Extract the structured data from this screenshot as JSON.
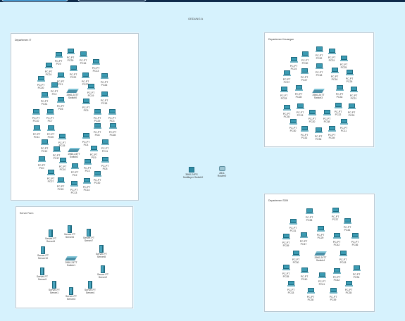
{
  "canvas_title": "GEDUNG A",
  "core": [
    {
      "model": "3560-24PS",
      "name": "Multilayer Switch0",
      "kind": "msw"
    },
    {
      "model": "2811",
      "name": "Router0",
      "kind": "rtr"
    }
  ],
  "areas": [
    {
      "label": "Departemen IT",
      "devices": [
        [
          "PC-PT",
          "PC30"
        ],
        [
          "PC-PT",
          "PC9"
        ],
        [
          "PC-PT",
          "PC16"
        ],
        [
          "PC-PT",
          "PC13"
        ],
        [
          "PC-PT",
          "PC24"
        ],
        [
          "PC-PT",
          "PC22"
        ],
        [
          "PC-PT",
          "PC1"
        ],
        [
          "PC-PT",
          "PC27"
        ],
        [
          "PC-PT",
          "PC26"
        ],
        [
          "PC-PT",
          "PC20"
        ],
        [
          "PC-PT",
          "PC2"
        ],
        [
          "PC-PT",
          "PC19"
        ],
        [
          "2960-24TT",
          "Switch0"
        ],
        [
          "PC-PT",
          "PC31"
        ],
        [
          "PC-PT",
          "PC18"
        ],
        [
          "PC-PT",
          "PC6"
        ],
        [
          "PC-PT",
          "PC5"
        ],
        [
          "PC-PT",
          "PC10"
        ],
        [
          "PC-PT",
          "PC7"
        ],
        [
          "PC-PT",
          "PC29"
        ],
        [
          "PC-PT",
          "PC3"
        ],
        [
          "PC-PT",
          "PC11"
        ],
        [
          "PC-PT",
          "PC20"
        ],
        [
          "PC-PT",
          "PC8"
        ],
        [
          "PC-PT",
          "PC28"
        ],
        [
          "PC-PT",
          "PC15"
        ],
        [
          "PC-PT",
          "PC4"
        ],
        [
          "PC-PT",
          "PC12"
        ],
        [
          "PC-PT",
          "PC11"
        ],
        [
          "2960-24TT",
          "Switch2"
        ],
        [
          "PC-PT",
          "PC17"
        ],
        [
          "PC-PT",
          "PC9"
        ],
        [
          "PC-PT",
          "PC0"
        ],
        [
          "PC-PT",
          "PC10"
        ],
        [
          "PC-PT",
          "PC3"
        ],
        [
          "PC-PT",
          "PC8"
        ],
        [
          "PC-PT",
          "PC2"
        ],
        [
          "PC-PT",
          "PC27"
        ],
        [
          "PC-PT",
          "PC30"
        ],
        [
          "PC-PT",
          "PC15"
        ],
        [
          "PC-PT",
          "PC14"
        ],
        [
          "PC-PT",
          "PC13"
        ]
      ]
    },
    {
      "label": "Departemen Keuangan",
      "devices": [
        [
          "PC-PT",
          "PC32"
        ],
        [
          "PC-PT",
          "PC31"
        ],
        [
          "PC-PT",
          "PC30"
        ],
        [
          "PC-PT",
          "PC25"
        ],
        [
          "PC-PT",
          "PC24"
        ],
        [
          "PC-PT",
          "PC18"
        ],
        [
          "PC-PT",
          "PC27"
        ],
        [
          "PC-PT",
          "PC16"
        ],
        [
          "PC-PT",
          "PC26"
        ],
        [
          "PC-PT",
          "PC37"
        ],
        [
          "2960-24TT",
          "Switch3"
        ],
        [
          "PC-PT",
          "PC28"
        ],
        [
          "PC-PT",
          "PC33"
        ],
        [
          "PC-PT",
          "PC34"
        ],
        [
          "PC-PT",
          "PC21"
        ],
        [
          "PC-PT",
          "PC13"
        ],
        [
          "PC-PT",
          "PC35"
        ],
        [
          "PC-PT",
          "PC22"
        ],
        [
          "PC-PT",
          "PC20"
        ],
        [
          "PC-PT",
          "PC20"
        ],
        [
          "PC-PT",
          "PC38"
        ],
        [
          "PC-PT",
          "PC30"
        ],
        [
          "PC-PT",
          "PC11"
        ],
        [
          "PC-PT",
          "PC32"
        ],
        [
          "PC-PT",
          "PC36"
        ],
        [
          "PC-PT",
          "PC39"
        ]
      ]
    },
    {
      "label": "Server Farm",
      "devices": [
        [
          "Server-PT",
          "Server5"
        ],
        [
          "Server-PT",
          "Server6"
        ],
        [
          "Server-PT",
          "Server7"
        ],
        [
          "Server-PT",
          "Server10"
        ],
        [
          "2960-24TT",
          "Switch1"
        ],
        [
          "Server-PT",
          "Server8"
        ],
        [
          "Server-PT",
          "Server9"
        ],
        [
          "Server-PT",
          "Server2"
        ],
        [
          "Server-PT",
          "Server1"
        ],
        [
          "Server-PT",
          "Server4"
        ],
        [
          "Server-PT",
          "Server3"
        ]
      ]
    },
    {
      "label": "Departemen SDM",
      "devices": [
        [
          "PC-PT",
          "PC38"
        ],
        [
          "PC-PT",
          "PC37"
        ],
        [
          "PC-PT",
          "PC31"
        ],
        [
          "PC-PT",
          "PC44"
        ],
        [
          "PC-PT",
          "PC29"
        ],
        [
          "PC-PT",
          "PC39"
        ],
        [
          "PC-PT",
          "PC47"
        ],
        [
          "PC-PT",
          "PC42"
        ],
        [
          "PC-PT",
          "PC36"
        ],
        [
          "2960-24TT",
          "Switch4"
        ],
        [
          "PC-PT",
          "PC30"
        ],
        [
          "PC-PT",
          "PC43"
        ],
        [
          "PC-PT",
          "PC35"
        ],
        [
          "PC-PT",
          "PC40"
        ],
        [
          "PC-PT",
          "PC42"
        ],
        [
          "PC-PT",
          "PC34"
        ],
        [
          "PC-PT",
          "PC41"
        ],
        [
          "PC-PT",
          "PC33"
        ],
        [
          "PC-PT",
          "PC35"
        ],
        [
          "PC-PT",
          "PC30"
        ],
        [
          "PC-PT",
          "PC39"
        ]
      ]
    }
  ]
}
